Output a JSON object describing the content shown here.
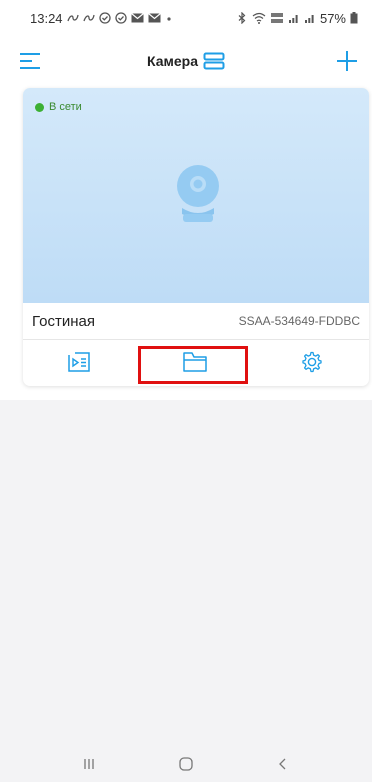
{
  "status_bar": {
    "time": "13:24",
    "battery": "57%",
    "icons": [
      "gmail-icon",
      "gmail-icon",
      "sync-icon",
      "sync-icon",
      "mail-icon",
      "mail-icon",
      "dot-icon",
      "bluetooth-icon",
      "wifi-icon",
      "volte-icon",
      "signal-icon",
      "signal-icon",
      "battery-icon"
    ]
  },
  "header": {
    "title": "Камера",
    "menu_icon": "hamburger-menu-icon",
    "layout_icon": "grid-layout-icon",
    "add_icon": "plus-icon"
  },
  "camera_card": {
    "status": "В сети",
    "name": "Гостиная",
    "device_id": "SSAA-534649-FDDBC",
    "actions": [
      {
        "icon": "playback-icon",
        "highlighted": false
      },
      {
        "icon": "folder-icon",
        "highlighted": true
      },
      {
        "icon": "gear-icon",
        "highlighted": false
      }
    ]
  },
  "navigation": {
    "buttons": [
      "recent-apps-icon",
      "home-icon",
      "back-icon"
    ]
  },
  "colors": {
    "accent": "#1e9ee6",
    "online": "#3cb034",
    "highlight": "#e01010",
    "preview_top": "#d4e9fa",
    "preview_bottom": "#bedcf6",
    "background": "#f3f3f5"
  }
}
